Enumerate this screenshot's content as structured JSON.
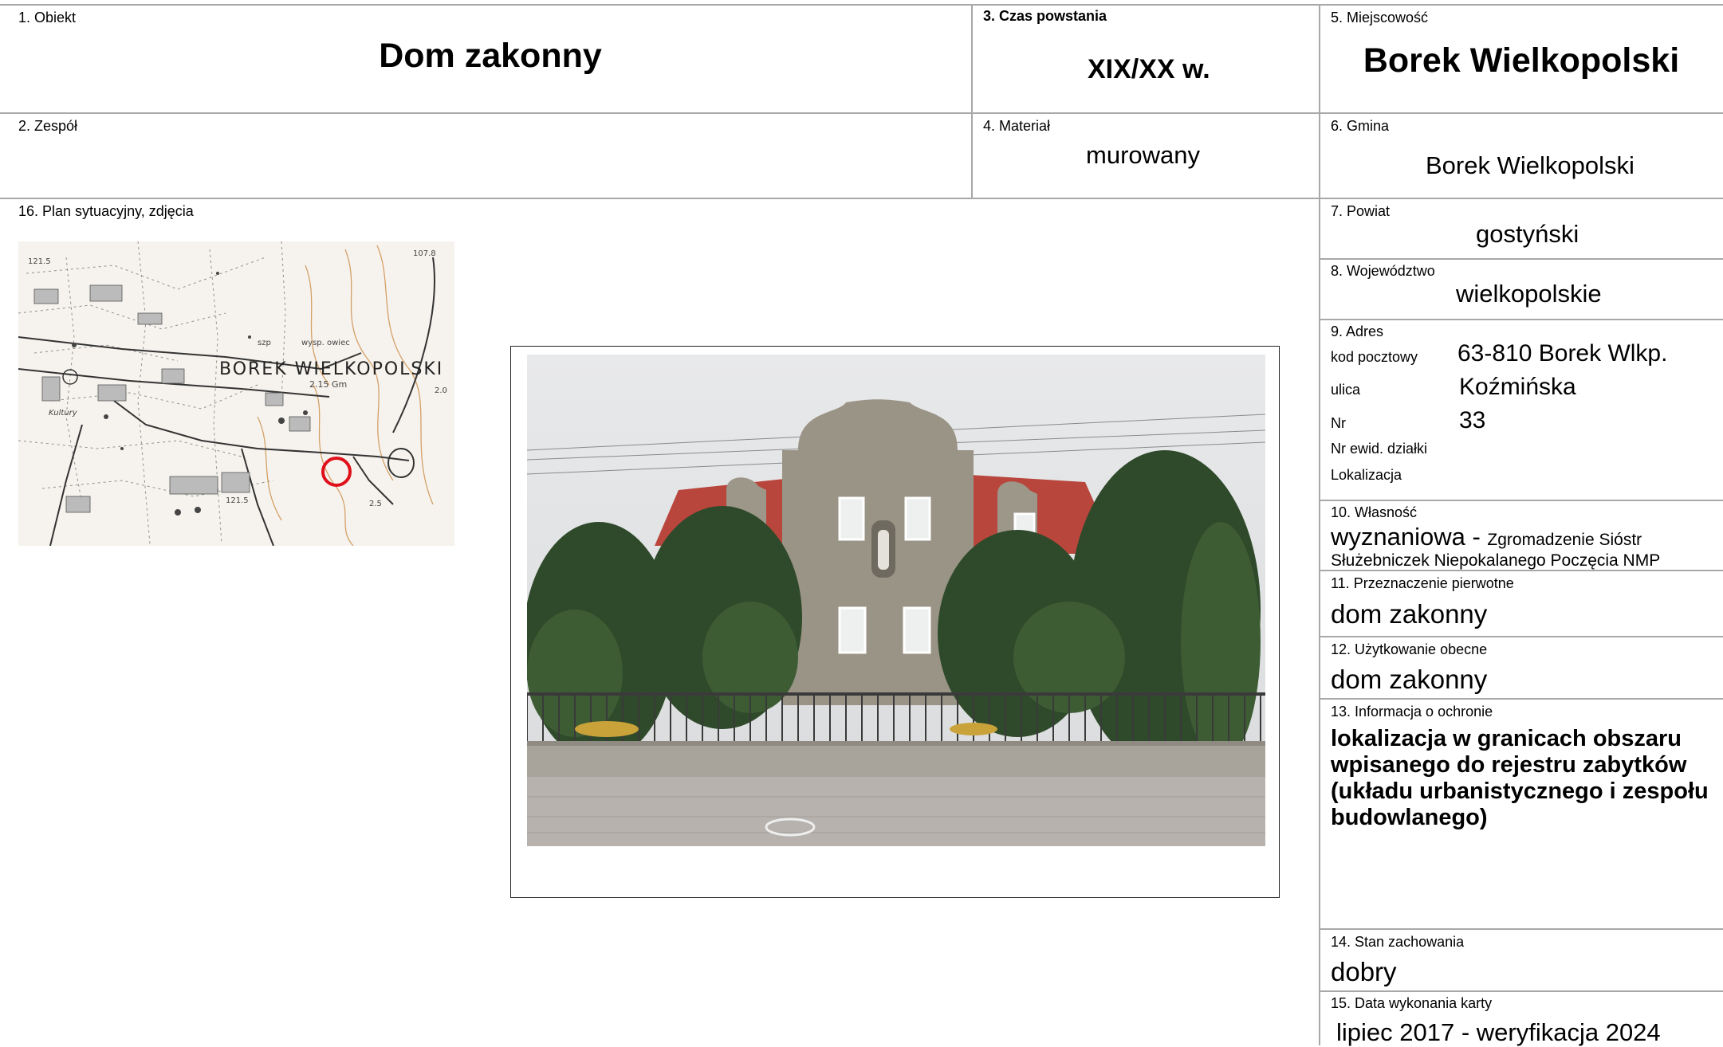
{
  "fields": {
    "f1": {
      "label": "1. Obiekt",
      "value": "Dom zakonny"
    },
    "f2": {
      "label": "2. Zespół",
      "value": ""
    },
    "f3": {
      "label": "3. Czas powstania",
      "value": "XIX/XX w."
    },
    "f4": {
      "label": "4. Materiał",
      "value": "murowany"
    },
    "f5": {
      "label": "5. Miejscowość",
      "value": "Borek Wielkopolski"
    },
    "f6": {
      "label": "6. Gmina",
      "value": "Borek Wielkopolski"
    },
    "f7": {
      "label": "7. Powiat",
      "value": "gostyński"
    },
    "f8": {
      "label": "8. Województwo",
      "value": "wielkopolskie"
    },
    "f9": {
      "label": "9. Adres",
      "postal_label": "kod pocztowy",
      "postal_value": "63-810 Borek Wlkp.",
      "street_label": "ulica",
      "street_value": "Koźmińska",
      "nr_label": "Nr",
      "nr_value": "33",
      "parcel_label": "Nr ewid. działki",
      "location_label": "Lokalizacja"
    },
    "f10": {
      "label": "10. Własność",
      "value_main": "wyznaniowa - ",
      "value_detail_1": "Zgromadzenie Sióstr",
      "value_detail_2": "Służebniczek Niepokalanego Poczęcia NMP"
    },
    "f11": {
      "label": "11. Przeznaczenie pierwotne",
      "value": "dom zakonny"
    },
    "f12": {
      "label": "12. Użytkowanie obecne",
      "value": "dom zakonny"
    },
    "f13": {
      "label": "13. Informacja o ochronie",
      "lines": [
        "lokalizacja w granicach obszaru",
        "wpisanego do rejestru zabytków",
        "(układu urbanistycznego i zespołu",
        "budowlanego)"
      ]
    },
    "f14": {
      "label": "14. Stan zachowania",
      "value": "dobry"
    },
    "f15": {
      "label": "15. Data wykonania karty",
      "value": "lipiec 2017 - weryfikacja 2024"
    },
    "f16": {
      "label": "16. Plan sytuacyjny, zdjęcia"
    }
  },
  "map": {
    "title_text": "BOREK WIELKOPOLSKI",
    "small_labels": [
      "2.15 Gm",
      "wysp. owiec",
      "szp",
      "107.8",
      "121.5",
      "121.5",
      "Kultury",
      "2.0",
      "2.5"
    ]
  },
  "colors": {
    "grid": "#a8a8a8",
    "marker": "#e0101a",
    "roof": "#b8463c",
    "facade": "#9a9486"
  }
}
